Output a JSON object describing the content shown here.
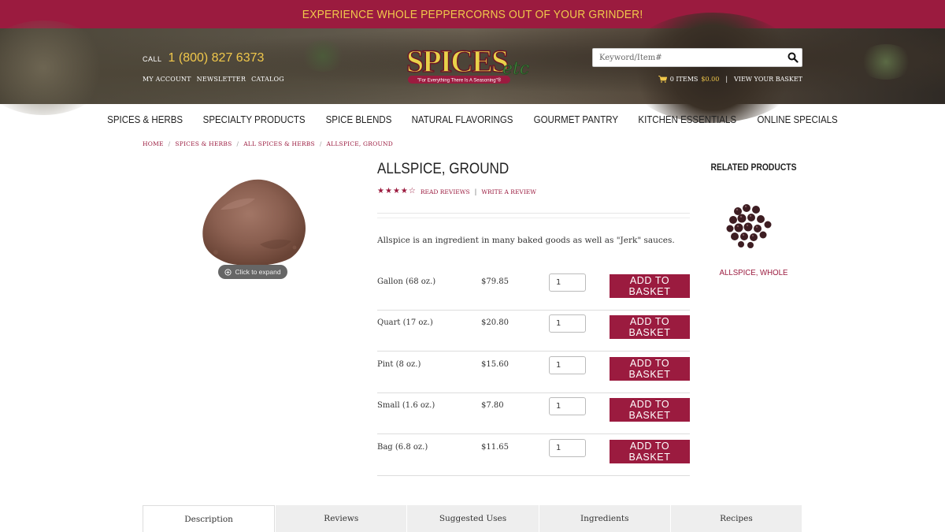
{
  "promo": {
    "text": "EXPERIENCE WHOLE PEPPERCORNS OUT OF YOUR GRINDER!"
  },
  "header": {
    "call_label": "CALL",
    "phone": "1 (800) 827 6373",
    "account_links": [
      "MY ACCOUNT",
      "NEWSLETTER",
      "CATALOG"
    ],
    "logo_text": "SPICES",
    "logo_etc": "etc",
    "logo_tagline": "\"For Everything There Is A Seasoning\"®",
    "search_placeholder": "Keyword/Item#",
    "basket_items": "0 ITEMS",
    "basket_amount": "$0.00",
    "basket_sep": "|",
    "view_basket": "VIEW YOUR BASKET"
  },
  "nav": {
    "items": [
      "SPICES & HERBS",
      "SPECIALTY PRODUCTS",
      "SPICE BLENDS",
      "NATURAL FLAVORINGS",
      "GOURMET PANTRY",
      "KITCHEN ESSENTIALS",
      "ONLINE SPECIALS"
    ]
  },
  "breadcrumb": {
    "items": [
      "HOME",
      "SPICES & HERBS",
      "ALL SPICES & HERBS",
      "ALLSPICE, GROUND"
    ],
    "sep": "/"
  },
  "product": {
    "title": "ALLSPICE, GROUND",
    "rating": 4,
    "rating_max": 5,
    "read_reviews": "READ REVIEWS",
    "bar": "|",
    "write_review": "WRITE A REVIEW",
    "description": "Allspice is an ingredient in many baked goods as well as \"Jerk\" sauces.",
    "expand_label": "Click to expand",
    "options": [
      {
        "size": "Gallon (68 oz.)",
        "price": "$79.85",
        "qty": "1",
        "button": "ADD TO BASKET"
      },
      {
        "size": "Quart (17 oz.)",
        "price": "$20.80",
        "qty": "1",
        "button": "ADD TO BASKET"
      },
      {
        "size": "Pint (8 oz.)",
        "price": "$15.60",
        "qty": "1",
        "button": "ADD TO BASKET"
      },
      {
        "size": "Small (1.6 oz.)",
        "price": "$7.80",
        "qty": "1",
        "button": "ADD TO BASKET"
      },
      {
        "size": "Bag (6.8 oz.)",
        "price": "$11.65",
        "qty": "1",
        "button": "ADD TO BASKET"
      }
    ]
  },
  "related": {
    "title": "RELATED PRODUCTS",
    "items": [
      {
        "name": "ALLSPICE, WHOLE"
      }
    ]
  },
  "tabs": {
    "items": [
      "Description",
      "Reviews",
      "Suggested Uses",
      "Ingredients",
      "Recipes"
    ],
    "active": "Description"
  },
  "colors": {
    "brand": "#9b1b3f",
    "accent_gold": "#f1c84b"
  },
  "icons": [
    "search-icon",
    "cart-icon",
    "star-icon",
    "zoom-icon"
  ]
}
